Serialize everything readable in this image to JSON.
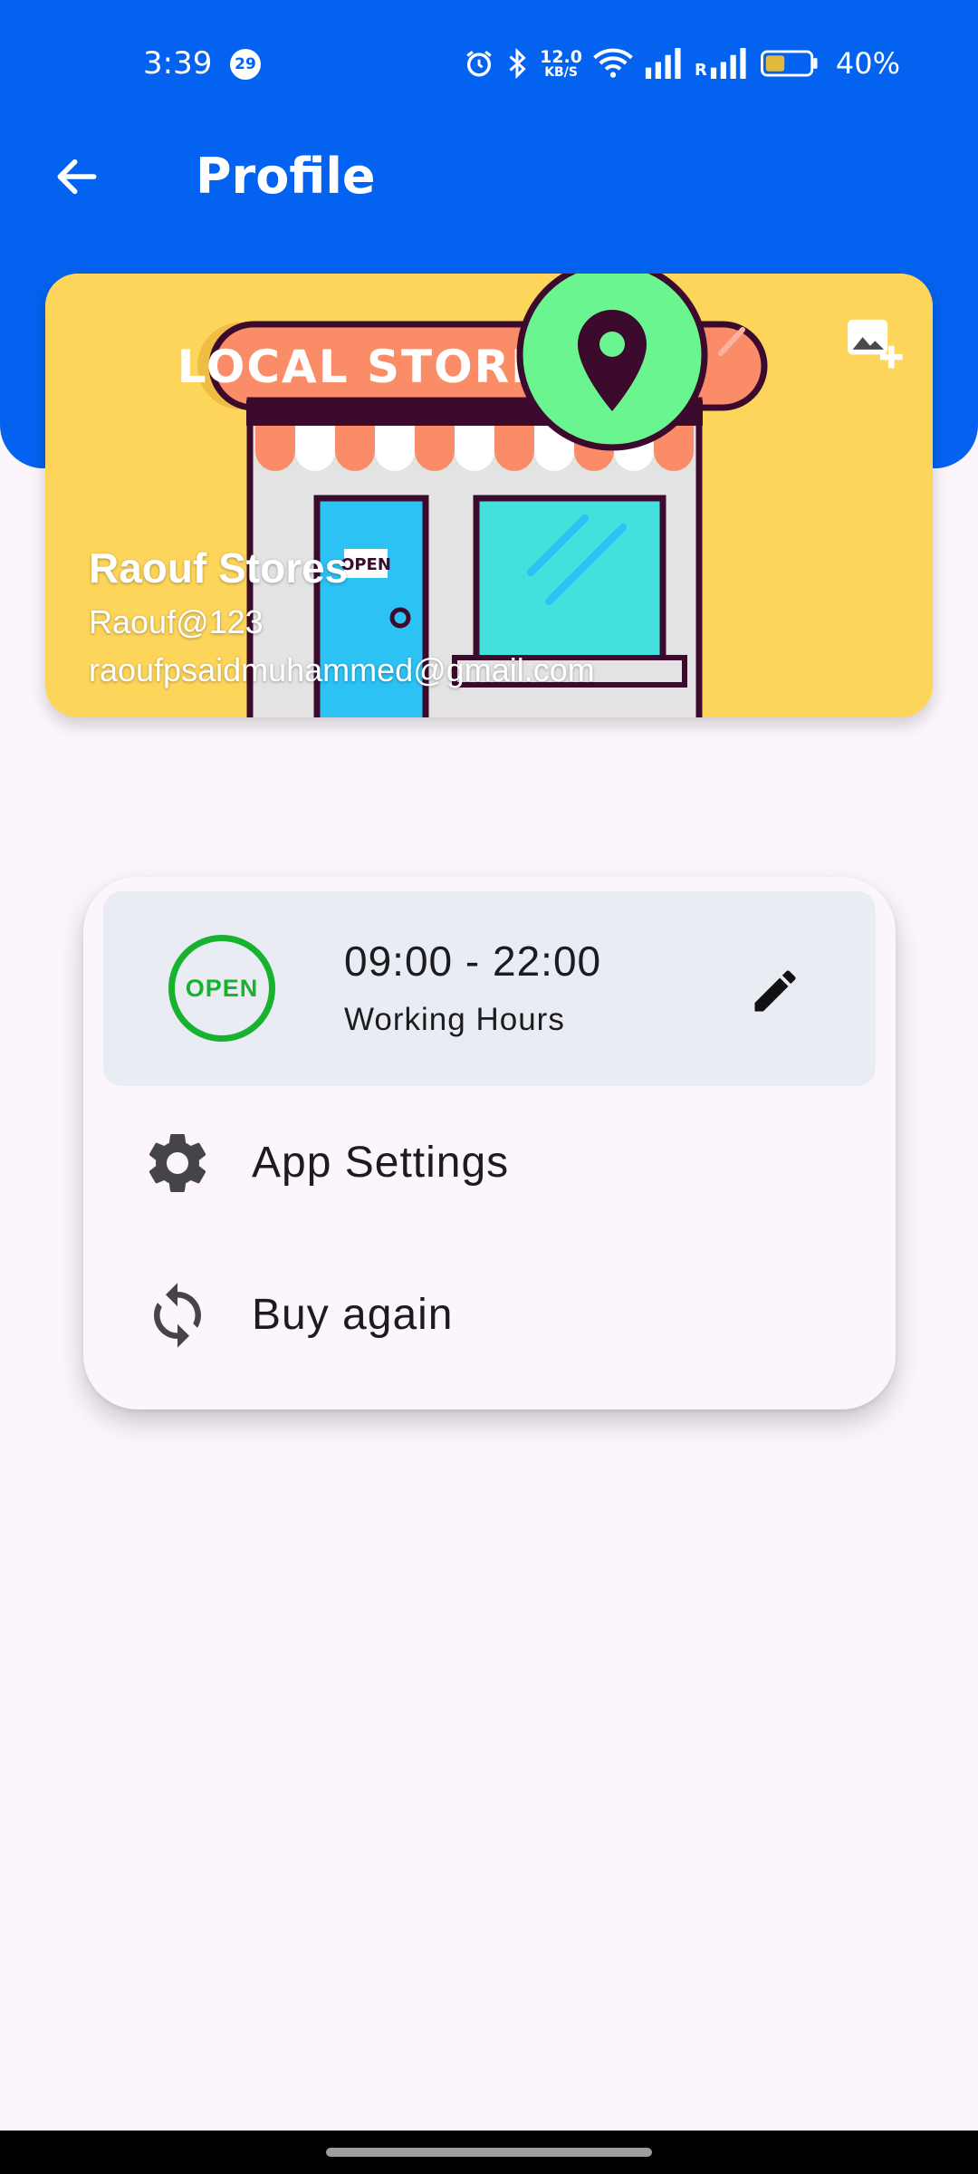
{
  "status_bar": {
    "time": "3:39",
    "notification_count": "29",
    "net_speed_value": "12.0",
    "net_speed_unit": "KB/S",
    "roaming_label": "R",
    "battery_percent": "40%"
  },
  "app_bar": {
    "title": "Profile",
    "back_icon": "arrow-left-icon"
  },
  "cover": {
    "artwork_sign": "LOCAL STORE",
    "door_sign": "OPEN",
    "add_photo_icon": "add-photo-icon",
    "store_name": "Raouf Stores",
    "username": "Raouf@123",
    "email": "raoufpsaidmuhammed@gmail.com"
  },
  "hours": {
    "status_badge": "OPEN",
    "time_range": "09:00 - 22:00",
    "label": "Working Hours",
    "edit_icon": "pencil-icon"
  },
  "menu": {
    "items": [
      {
        "label": "App Settings",
        "icon": "gear-icon"
      },
      {
        "label": "Buy again",
        "icon": "refresh-icon"
      }
    ]
  },
  "colors": {
    "primary": "#0362EF",
    "background": "#FCF6FC",
    "open_green": "#17B22E",
    "hours_bg": "#E9ECF2",
    "cover_yellow": "#FDD55A"
  }
}
